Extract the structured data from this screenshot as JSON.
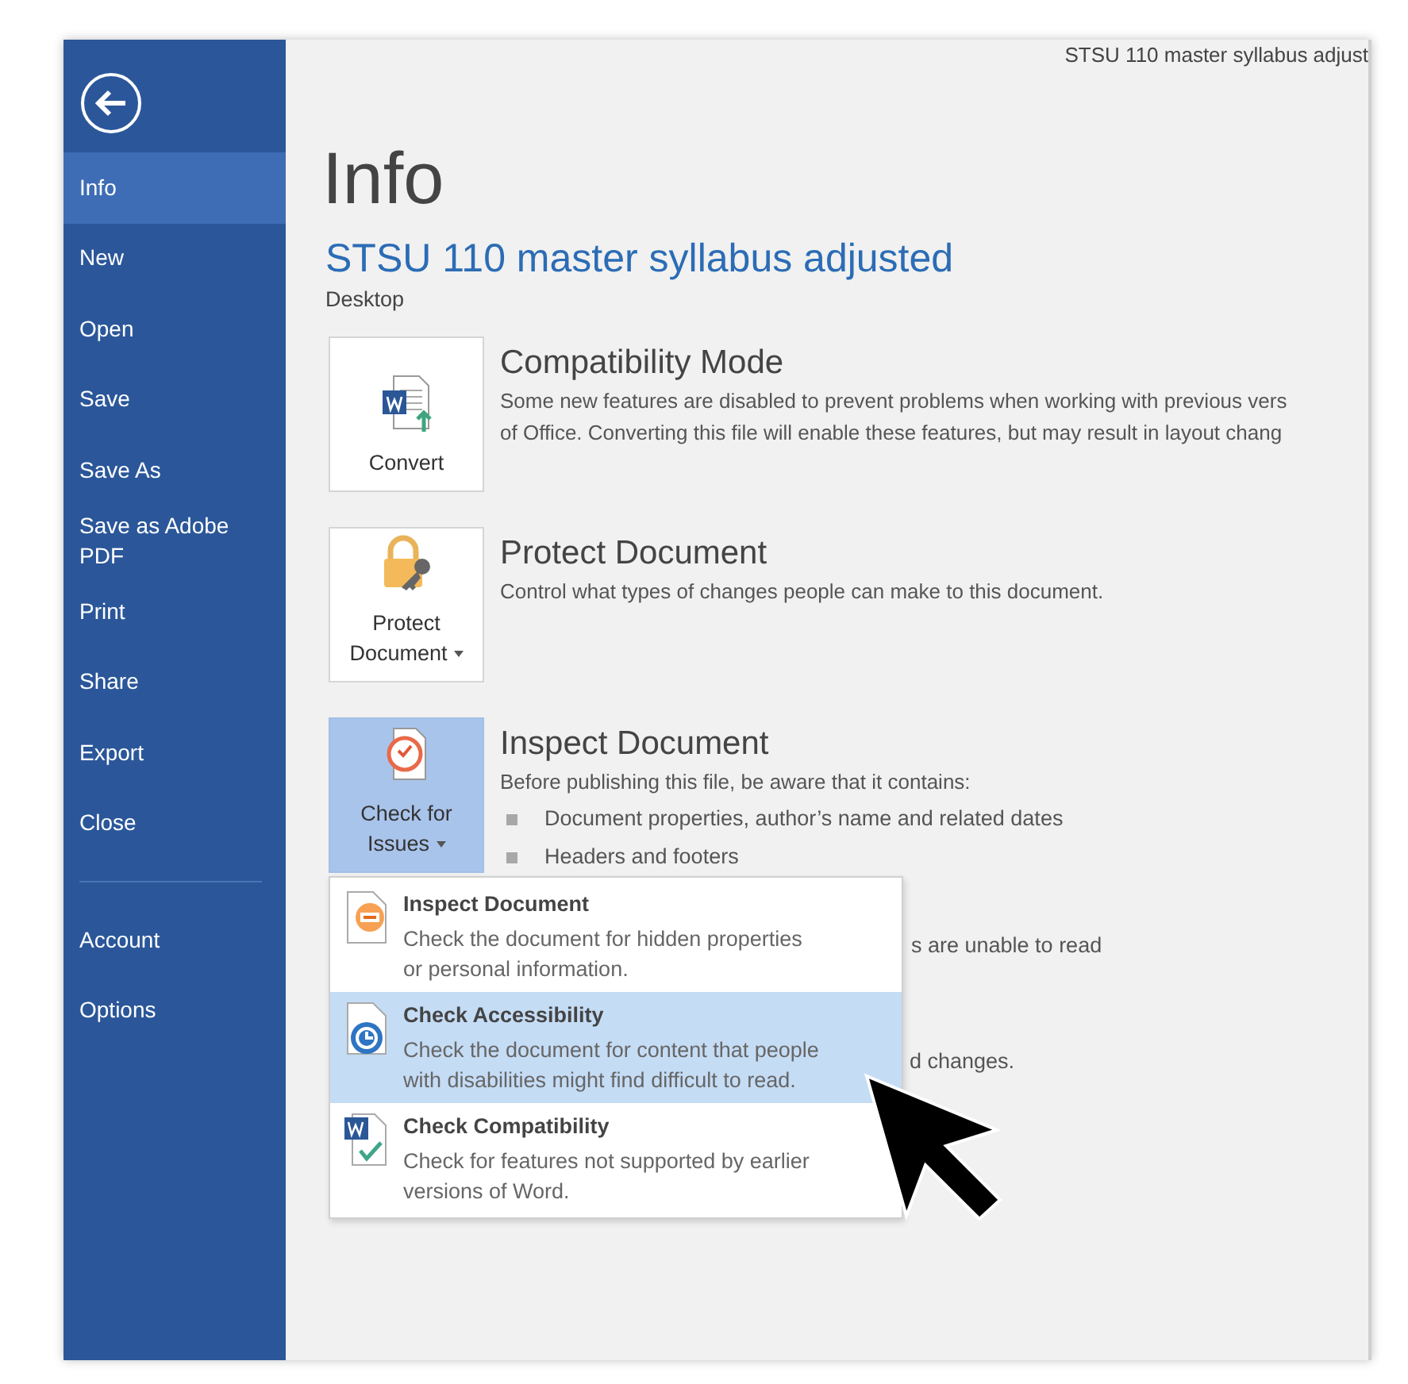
{
  "title_bar": {
    "text": "STSU 110 master syllabus adjust"
  },
  "sidebar": {
    "items": [
      {
        "label": "Info",
        "selected": true
      },
      {
        "label": "New",
        "selected": false
      },
      {
        "label": "Open",
        "selected": false
      },
      {
        "label": "Save",
        "selected": false
      },
      {
        "label": "Save As",
        "selected": false
      },
      {
        "label": "Save as Adobe PDF",
        "selected": false
      },
      {
        "label": "Print",
        "selected": false
      },
      {
        "label": "Share",
        "selected": false
      },
      {
        "label": "Export",
        "selected": false
      },
      {
        "label": "Close",
        "selected": false
      }
    ],
    "bottom_items": [
      {
        "label": "Account",
        "selected": false
      },
      {
        "label": "Options",
        "selected": false
      }
    ]
  },
  "heading": "Info",
  "document": {
    "name": "STSU 110 master syllabus adjusted",
    "location": "Desktop"
  },
  "sections": [
    {
      "kind": "convert",
      "button": {
        "label": "Convert",
        "dropdown": false,
        "pressed": false
      },
      "title": "Compatibility Mode",
      "lines": [
        "Some new features are disabled to prevent problems when working with previous vers",
        "of Office. Converting this file will enable these features, but may result in layout chang"
      ]
    },
    {
      "kind": "protect",
      "button": {
        "label": "Protect Document",
        "dropdown": true,
        "pressed": false
      },
      "title": "Protect Document",
      "lines": [
        "Control what types of changes people can make to this document."
      ]
    },
    {
      "kind": "inspect",
      "button": {
        "label": "Check for Issues",
        "dropdown": true,
        "pressed": true
      },
      "title": "Inspect Document",
      "lines": [
        "Before publishing this file, be aware that it contains:"
      ],
      "bullets": [
        "Document properties, author’s name and related dates",
        "Headers and footers"
      ],
      "partial_lines": [
        "s are unable to read",
        "d changes."
      ]
    }
  ],
  "menu": {
    "items": [
      {
        "kind": "inspect",
        "title": "Inspect Document",
        "lines": [
          "Check the document for hidden properties",
          "or personal information."
        ],
        "selected": false
      },
      {
        "kind": "accessibility",
        "title": "Check Accessibility",
        "lines": [
          "Check the document for content that people",
          "with disabilities might find difficult to read."
        ],
        "selected": true
      },
      {
        "kind": "compatibility",
        "title": "Check Compatibility",
        "lines": [
          "Check for features not supported by earlier",
          "versions of Word."
        ],
        "selected": false
      }
    ]
  }
}
